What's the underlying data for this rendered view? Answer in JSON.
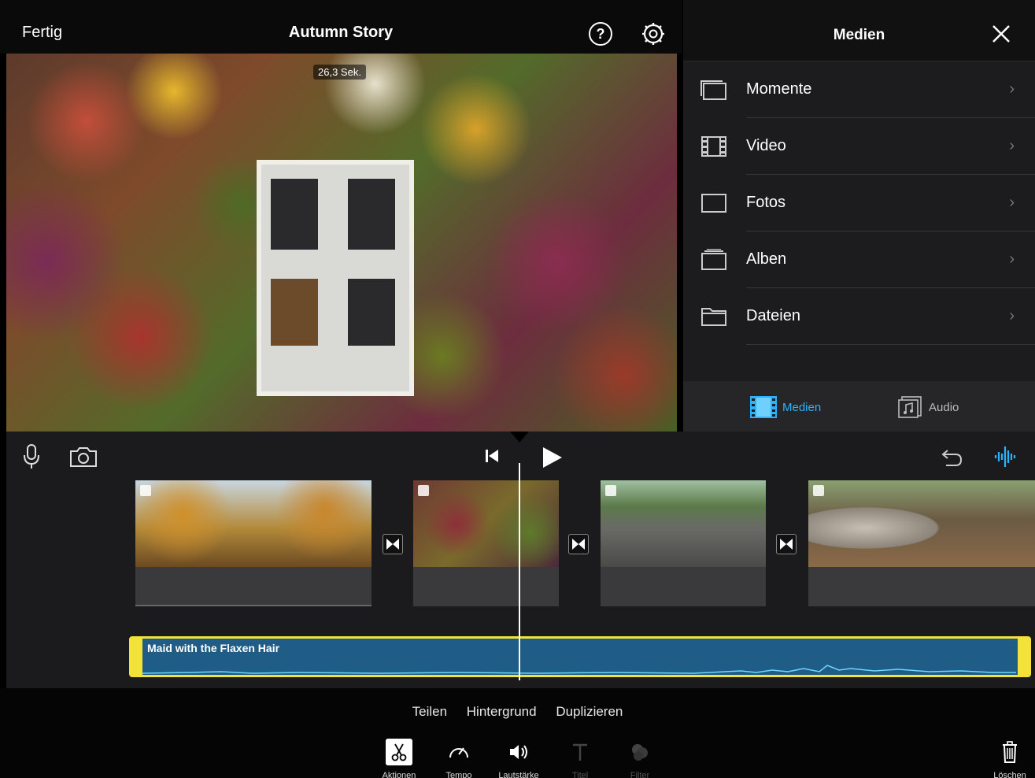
{
  "topbar": {
    "done_label": "Fertig",
    "project_title": "Autumn Story",
    "help_label": "?"
  },
  "preview": {
    "duration_label": "26,3 Sek."
  },
  "media_panel": {
    "title": "Medien",
    "items": [
      {
        "label": "Momente",
        "icon": "moments-icon"
      },
      {
        "label": "Video",
        "icon": "film-icon"
      },
      {
        "label": "Fotos",
        "icon": "photo-icon"
      },
      {
        "label": "Alben",
        "icon": "album-icon"
      },
      {
        "label": "Dateien",
        "icon": "folder-icon"
      }
    ],
    "chevron": "›",
    "tabs": {
      "media_label": "Medien",
      "audio_label": "Audio"
    }
  },
  "timeline": {
    "audio_track_name": "Maid with the Flaxen Hair"
  },
  "bottom": {
    "actions": [
      "Teilen",
      "Hintergrund",
      "Duplizieren"
    ],
    "tools": [
      {
        "label": "Aktionen",
        "icon": "scissors-icon",
        "state": "active"
      },
      {
        "label": "Tempo",
        "icon": "speedometer-icon",
        "state": "enabled"
      },
      {
        "label": "Lautstärke",
        "icon": "speaker-icon",
        "state": "enabled"
      },
      {
        "label": "Titel",
        "icon": "title-icon",
        "state": "disabled"
      },
      {
        "label": "Filter",
        "icon": "filter-icon",
        "state": "disabled"
      }
    ],
    "delete_label": "Löschen"
  },
  "colors": {
    "accent": "#2ab2ff",
    "audio_track": "#1f5d86",
    "audio_border": "#f2e23a",
    "background": "#000000"
  }
}
